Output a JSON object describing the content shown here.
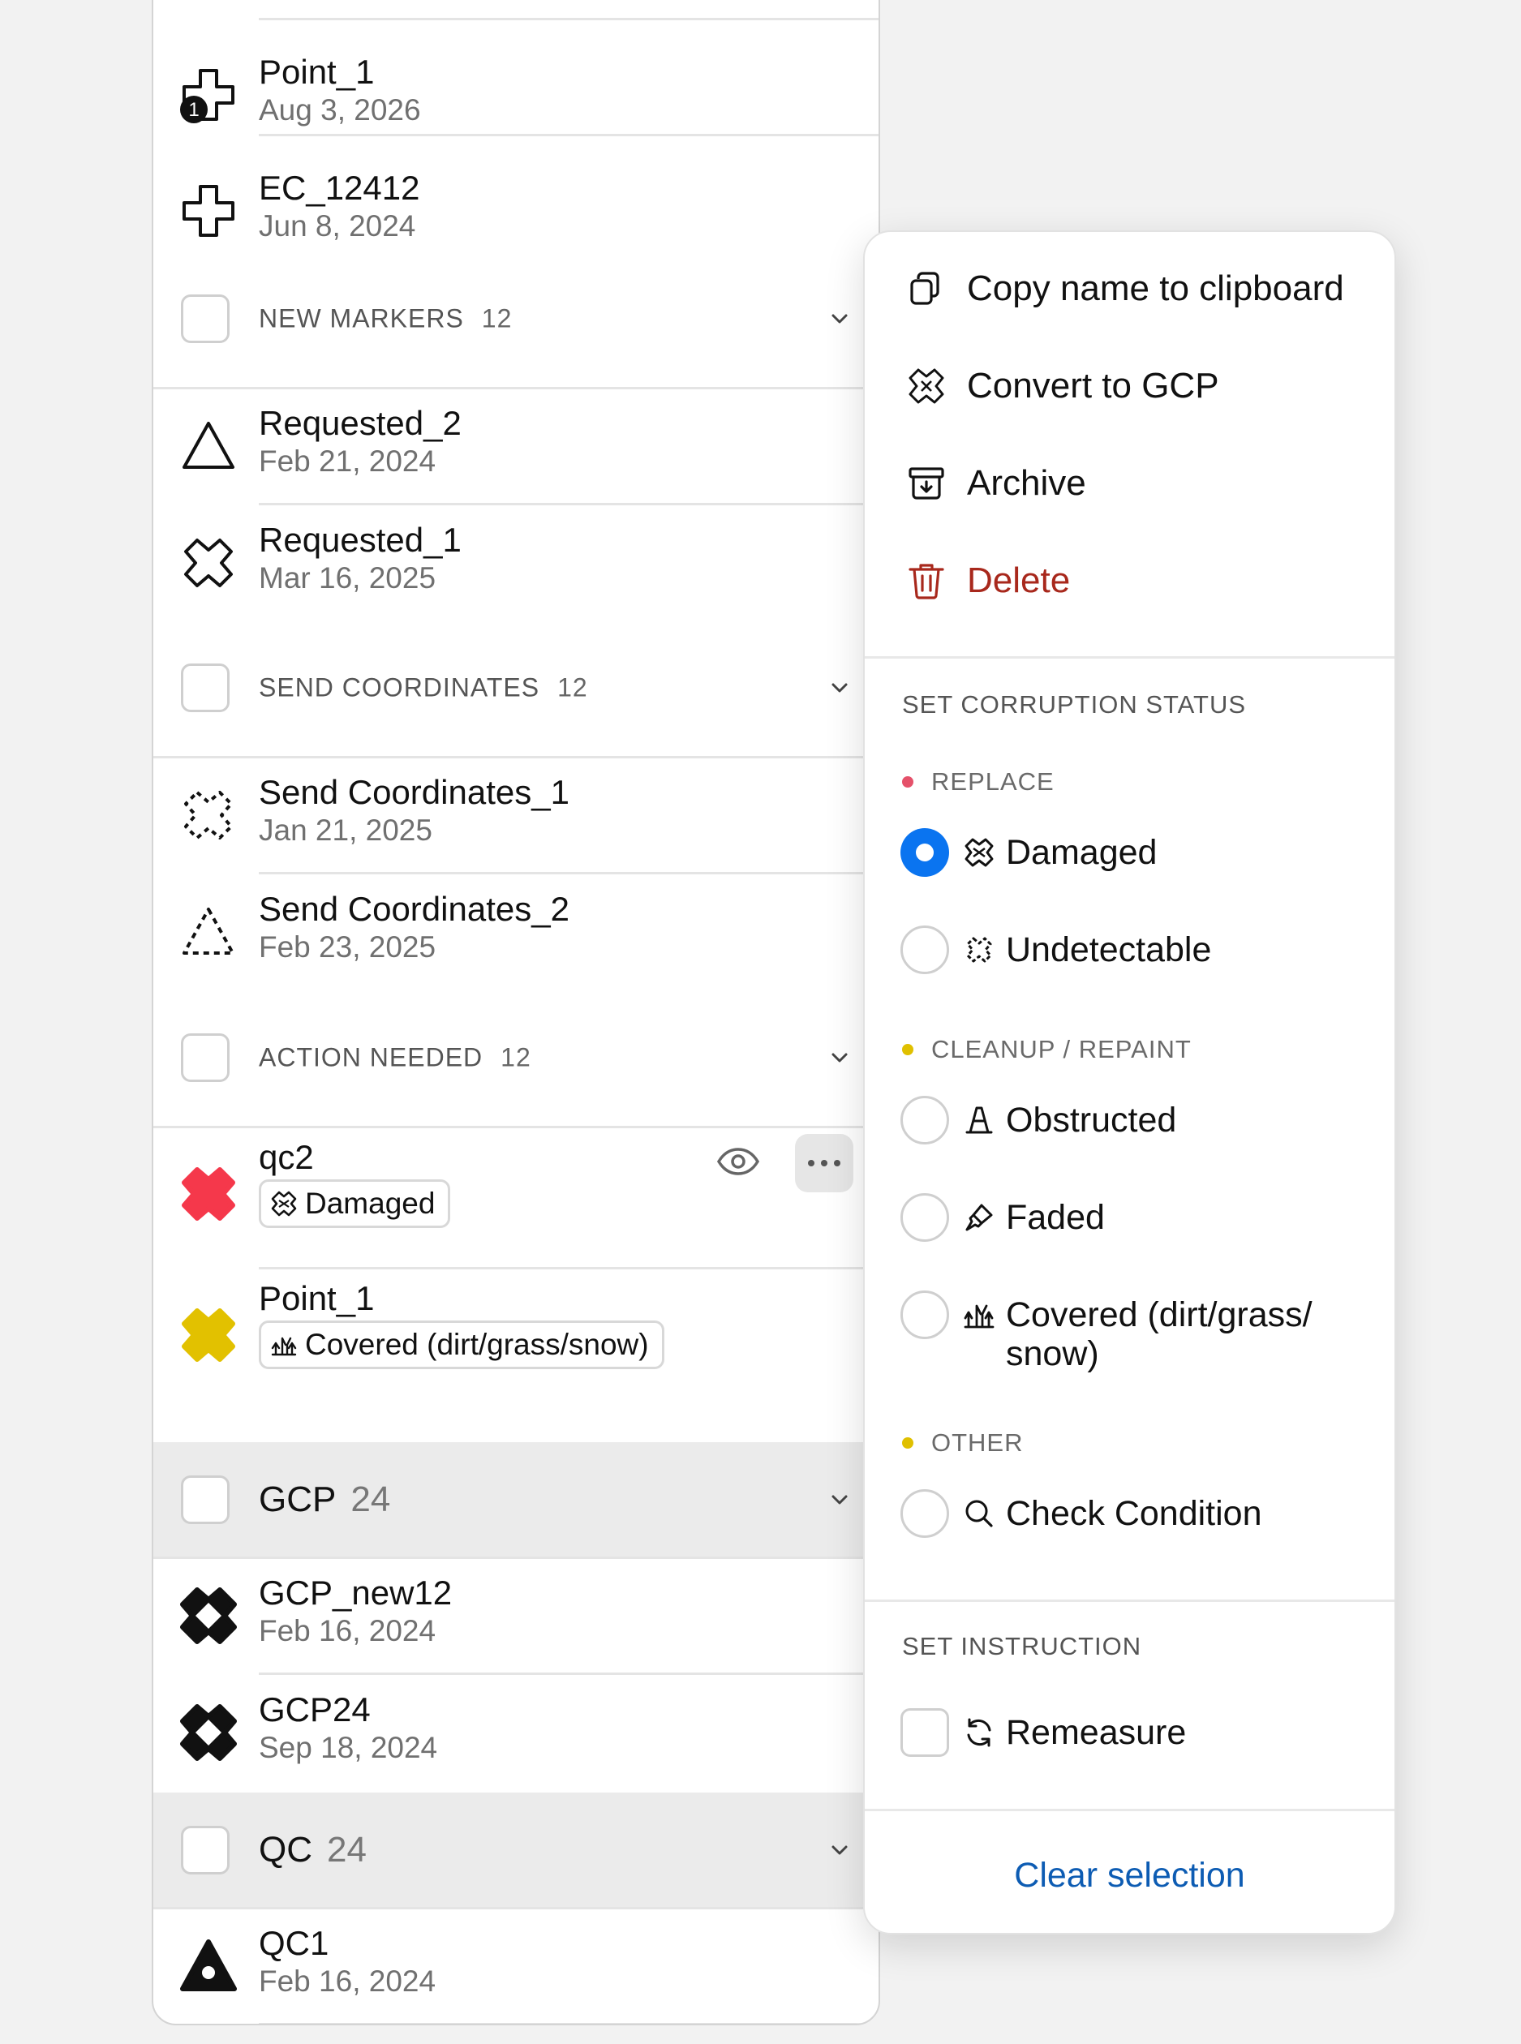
{
  "colors": {
    "accent_blue": "#0a74f0",
    "link_blue": "#0d5cb3",
    "danger_red": "#a8281c",
    "replace_dot": "#e5516a",
    "cleanup_dot": "#e0c000",
    "other_dot": "#e0c000",
    "marker_red": "#f5384b",
    "marker_yellow": "#e2c100"
  },
  "list": {
    "items_top": [
      {
        "title": "Point_1",
        "date": "Aug 3, 2026",
        "icon": "plus-outline-badge-icon",
        "badge": "1"
      },
      {
        "title": "EC_12412",
        "date": "Jun 8, 2024",
        "icon": "plus-outline-icon"
      }
    ],
    "groups": {
      "new_markers": {
        "label": "NEW MARKERS",
        "count": "12"
      },
      "send_coordinates": {
        "label": "SEND COORDINATES",
        "count": "12"
      },
      "action_needed": {
        "label": "ACTION NEEDED",
        "count": "12"
      },
      "gcp": {
        "label": "GCP",
        "count": "24"
      },
      "qc": {
        "label": "QC",
        "count": "24"
      }
    },
    "new_markers_items": [
      {
        "title": "Requested_2",
        "date": "Feb 21, 2024",
        "icon": "triangle-outline-icon"
      },
      {
        "title": "Requested_1",
        "date": "Mar 16, 2025",
        "icon": "x-outline-icon"
      }
    ],
    "send_coordinates_items": [
      {
        "title": "Send Coordinates_1",
        "date": "Jan 21, 2025",
        "icon": "x-dashed-icon"
      },
      {
        "title": "Send Coordinates_2",
        "date": "Feb 23, 2025",
        "icon": "triangle-dashed-icon"
      }
    ],
    "action_needed_items": [
      {
        "title": "qc2",
        "chip": "Damaged",
        "chip_icon": "damaged-icon",
        "icon": "x-filled-red-icon"
      },
      {
        "title": "Point_1",
        "chip": "Covered (dirt/grass/snow)",
        "chip_icon": "grass-icon",
        "icon": "x-filled-yellow-icon"
      }
    ],
    "gcp_items": [
      {
        "title": "GCP_new12",
        "date": "Feb 16, 2024",
        "icon": "gcp-filled-icon"
      },
      {
        "title": "GCP24",
        "date": "Sep 18, 2024",
        "icon": "gcp-filled-icon"
      }
    ],
    "qc_items": [
      {
        "title": "QC1",
        "date": "Feb 16, 2024",
        "icon": "triangle-filled-icon"
      }
    ]
  },
  "menu": {
    "actions": [
      {
        "label": "Copy name to clipboard",
        "icon": "copy-icon"
      },
      {
        "label": "Convert to GCP",
        "icon": "convert-icon"
      },
      {
        "label": "Archive",
        "icon": "archive-icon"
      },
      {
        "label": "Delete",
        "icon": "trash-icon"
      }
    ],
    "corruption_section": "SET CORRUPTION STATUS",
    "replace_label": "REPLACE",
    "replace_options": [
      {
        "label": "Damaged",
        "icon": "damaged-icon",
        "selected": true
      },
      {
        "label": "Undetectable",
        "icon": "undetectable-icon",
        "selected": false
      }
    ],
    "cleanup_label": "CLEANUP / REPAINT",
    "cleanup_options": [
      {
        "label": "Obstructed",
        "icon": "cone-icon",
        "selected": false
      },
      {
        "label": "Faded",
        "icon": "brush-icon",
        "selected": false
      },
      {
        "label": "Covered (dirt/grass/ snow)",
        "line1": "Covered (dirt/grass/",
        "line2": "snow)",
        "icon": "grass-icon",
        "selected": false
      }
    ],
    "other_label": "OTHER",
    "other_options": [
      {
        "label": "Check Condition",
        "icon": "search-icon",
        "selected": false
      }
    ],
    "instruction_section": "SET INSTRUCTION",
    "instruction_options": [
      {
        "label": "Remeasure",
        "icon": "refresh-icon",
        "checked": false
      }
    ],
    "clear_label": "Clear selection"
  }
}
